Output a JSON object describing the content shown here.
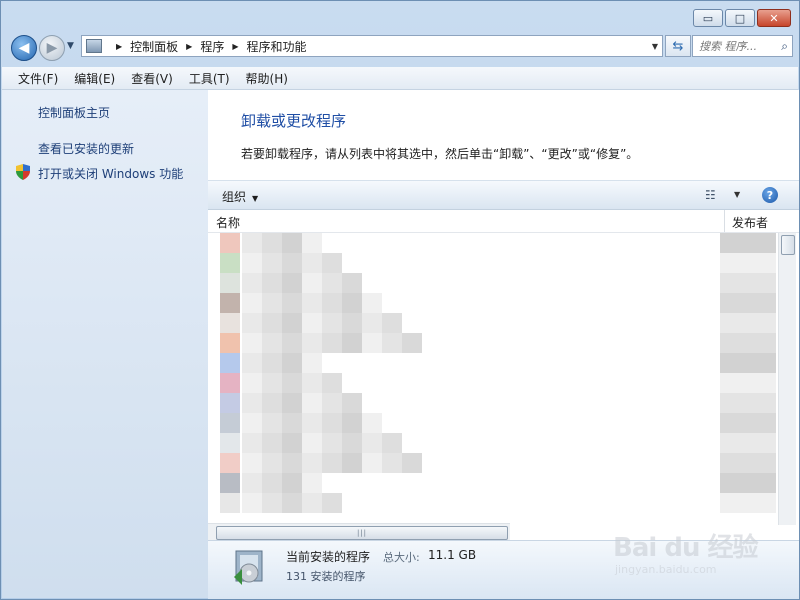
{
  "window": {
    "caption_buttons": {
      "minimize": "▭",
      "maximize": "□",
      "close": "✕"
    }
  },
  "nav": {
    "back_icon": "◀",
    "forward_icon": "▶",
    "history_dropdown_icon": "▼",
    "breadcrumbs": [
      "控制面板",
      "程序",
      "程序和功能"
    ],
    "crumb_separator": "▶",
    "address_dropdown_icon": "▼",
    "refresh_icon": "⇆",
    "search_placeholder": "搜索 程序...",
    "search_icon": "⌕"
  },
  "menubar": {
    "items": [
      "文件(F)",
      "编辑(E)",
      "查看(V)",
      "工具(T)",
      "帮助(H)"
    ]
  },
  "left_pane": {
    "links": [
      "控制面板主页",
      "查看已安装的更新",
      "打开或关闭 Windows 功能"
    ],
    "shield_colors": [
      "#2f6fcc",
      "#f2c230",
      "#2f9a3c",
      "#d43b2c"
    ]
  },
  "main": {
    "title": "卸载或更改程序",
    "description": "若要卸载程序，请从列表中将其选中，然后单击“卸载”、“更改”或“修复”。",
    "toolbar": {
      "organize_label": "组织",
      "caret": "▼",
      "view_icon": "☷",
      "view_caret": "▼",
      "help_icon": "?"
    },
    "columns": {
      "name": "名称",
      "publisher": "发布者"
    },
    "scroll_grip": "|||"
  },
  "details": {
    "title": "当前安装的程序",
    "size_label": "总大小:",
    "size_value": "11.1 GB",
    "count": "131 安装的程序"
  },
  "watermark": {
    "text": "Bai du 经验",
    "sub": "jingyan.baidu.com"
  }
}
